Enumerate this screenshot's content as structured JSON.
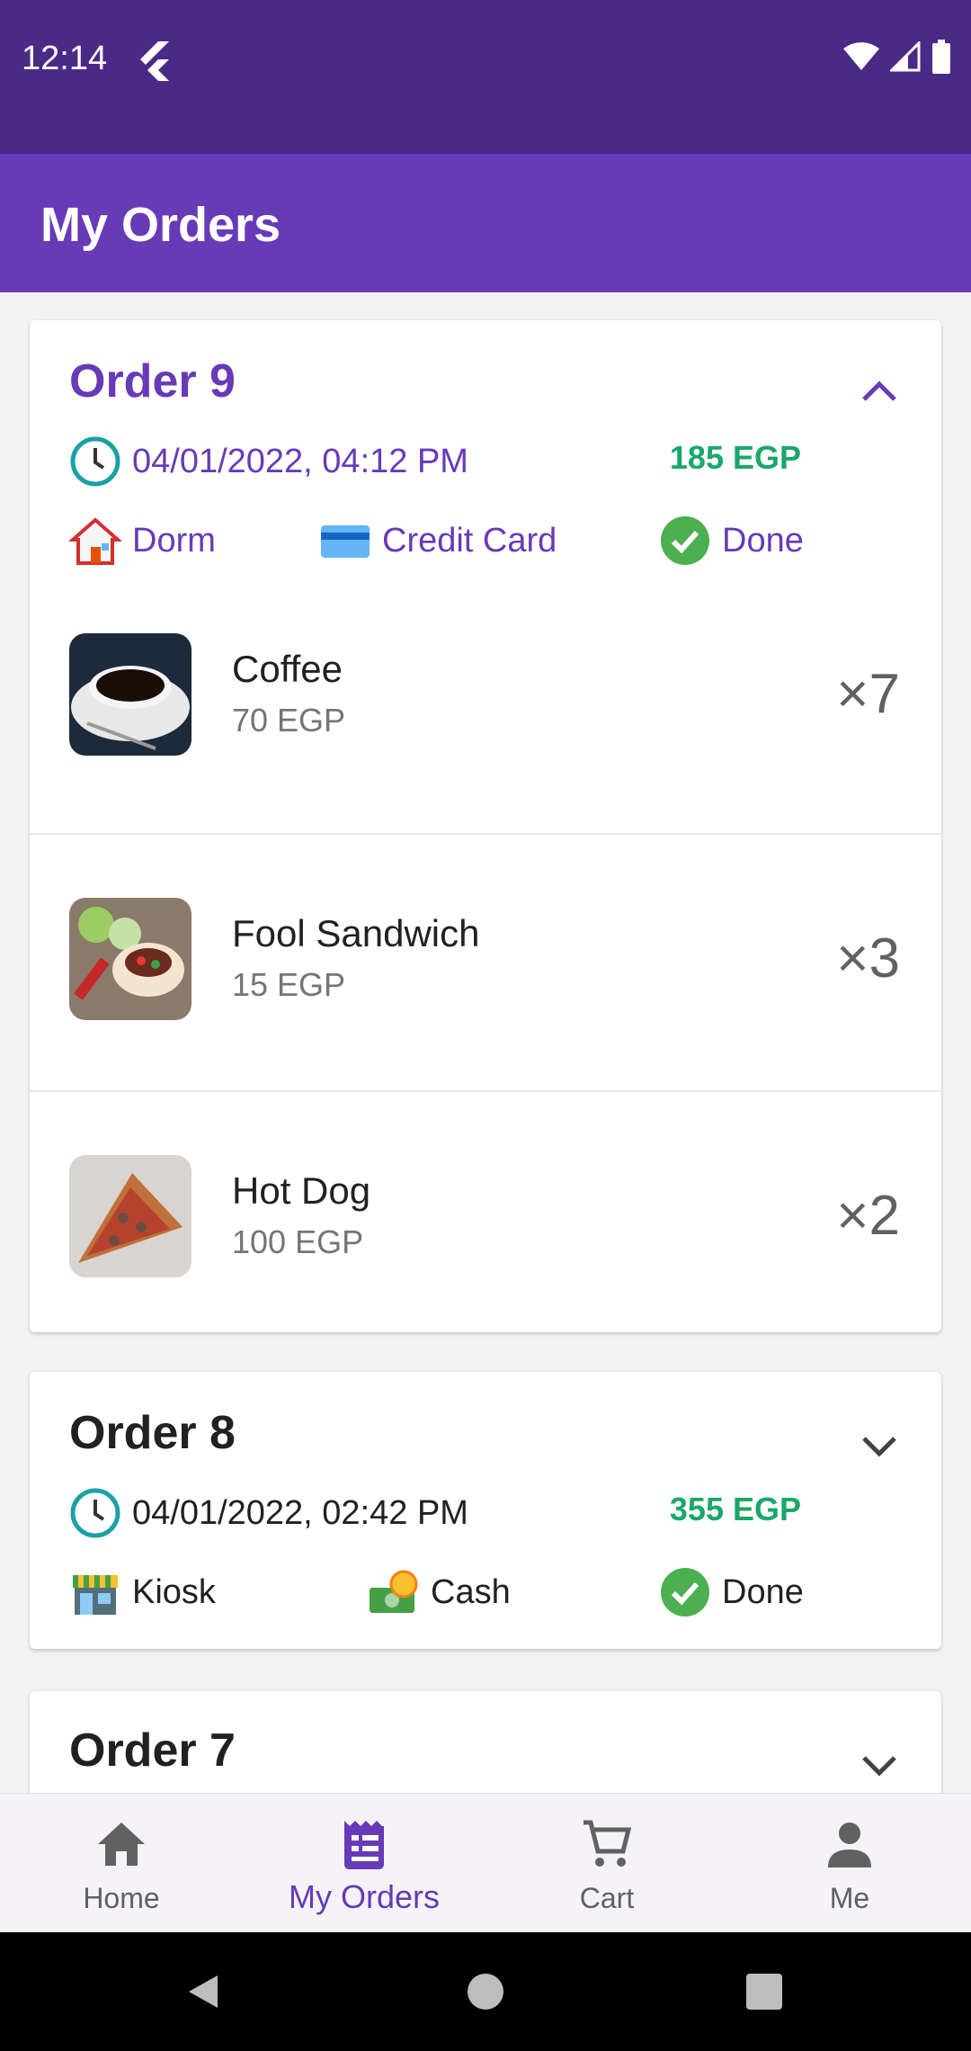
{
  "status_bar": {
    "time": "12:14"
  },
  "app_bar": {
    "title": "My Orders"
  },
  "orders": [
    {
      "title": "Order 9",
      "datetime": "04/01/2022, 04:12 PM",
      "total": "185 EGP",
      "location": "Dorm",
      "payment": "Credit Card",
      "status": "Done",
      "expanded": true,
      "items": [
        {
          "name": "Coffee",
          "price": "70 EGP",
          "qty": "×7"
        },
        {
          "name": "Fool Sandwich",
          "price": "15 EGP",
          "qty": "×3"
        },
        {
          "name": "Hot Dog",
          "price": "100 EGP",
          "qty": "×2"
        }
      ]
    },
    {
      "title": "Order 8",
      "datetime": "04/01/2022, 02:42 PM",
      "total": "355 EGP",
      "location": "Kiosk",
      "payment": "Cash",
      "status": "Done",
      "expanded": false
    },
    {
      "title": "Order 7",
      "expanded": false
    }
  ],
  "bottom_nav": {
    "items": [
      {
        "label": "Home",
        "icon": "home-icon"
      },
      {
        "label": "My Orders",
        "icon": "receipt-icon",
        "active": true
      },
      {
        "label": "Cart",
        "icon": "cart-icon"
      },
      {
        "label": "Me",
        "icon": "person-icon"
      }
    ]
  },
  "colors": {
    "primary": "#673ab7",
    "status_bar": "#4a2a86",
    "price_green": "#1aa86a",
    "done_green": "#4caf50"
  }
}
